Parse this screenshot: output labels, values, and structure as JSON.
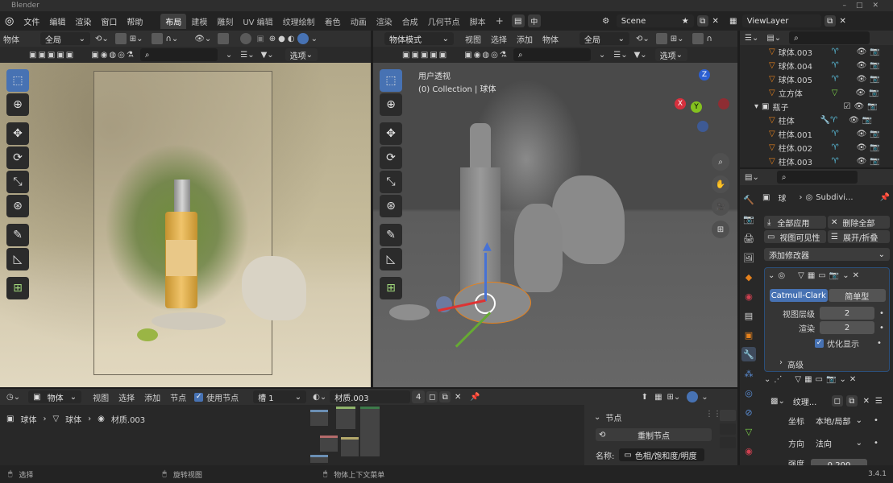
{
  "app": {
    "title": "Blender",
    "version": "3.4.1"
  },
  "menu": [
    "文件",
    "编辑",
    "渲染",
    "窗口",
    "帮助"
  ],
  "workspaces": [
    "布局",
    "建模",
    "雕刻",
    "UV 编辑",
    "纹理绘制",
    "着色",
    "动画",
    "渲染",
    "合成",
    "几何节点",
    "脚本"
  ],
  "scene": {
    "name": "Scene",
    "view_layer": "ViewLayer"
  },
  "left_view": {
    "mode": "物体",
    "global": "全局",
    "options": "选项"
  },
  "right_view": {
    "mode": "物体模式",
    "menu": [
      "视图",
      "选择",
      "添加",
      "物体"
    ],
    "global": "全局",
    "options": "选项",
    "title": "用户透视",
    "subtitle": "(0) Collection | 球体"
  },
  "gizmo": {
    "x": "X",
    "y": "Y",
    "z": "Z"
  },
  "outliner": {
    "rows": [
      {
        "name": "球体.003",
        "indent": 1
      },
      {
        "name": "球体.004",
        "indent": 1
      },
      {
        "name": "球体.005",
        "indent": 1
      },
      {
        "name": "立方体",
        "indent": 1
      },
      {
        "name": "瓶子",
        "indent": 0
      },
      {
        "name": "柱体",
        "indent": 1
      },
      {
        "name": "柱体.001",
        "indent": 1
      },
      {
        "name": "柱体.002",
        "indent": 1
      },
      {
        "name": "柱体.003",
        "indent": 1
      }
    ]
  },
  "properties": {
    "object": "球",
    "modifier": "Subdivi...",
    "apply_all": "全部应用",
    "delete_all": "删除全部",
    "viewport_vis": "视图可见性",
    "expand": "展开/折叠",
    "add_modifier": "添加修改器",
    "catmull": "Catmull-Clark",
    "simple": "简单型",
    "levels_label": "视图层级",
    "levels": "2",
    "render_label": "渲染",
    "render": "2",
    "optimize": "优化显示",
    "advanced": "高级",
    "texture": "纹理...",
    "coords_label": "坐标",
    "coords": "本地/局部",
    "direction_label": "方向",
    "direction": "法向",
    "strength_label": "强度",
    "strength": "0.200"
  },
  "node_editor": {
    "object": "物体",
    "menu": [
      "视图",
      "选择",
      "添加",
      "节点"
    ],
    "use_nodes": "使用节点",
    "slot": "槽 1",
    "material": "材质.003",
    "users": "4",
    "breadcrumb": [
      "球体",
      "球体",
      "材质.003"
    ]
  },
  "node_panel": {
    "section": "节点",
    "reset": "重制节点",
    "name_label": "名称:",
    "name": "色相/饱和度/明度"
  },
  "status": {
    "select": "选择",
    "rotate": "旋转视图",
    "context": "物体上下文菜单"
  },
  "colors": {
    "accent": "#4772b3",
    "orange": "#e5811c",
    "bg": "#1d1d1d"
  }
}
